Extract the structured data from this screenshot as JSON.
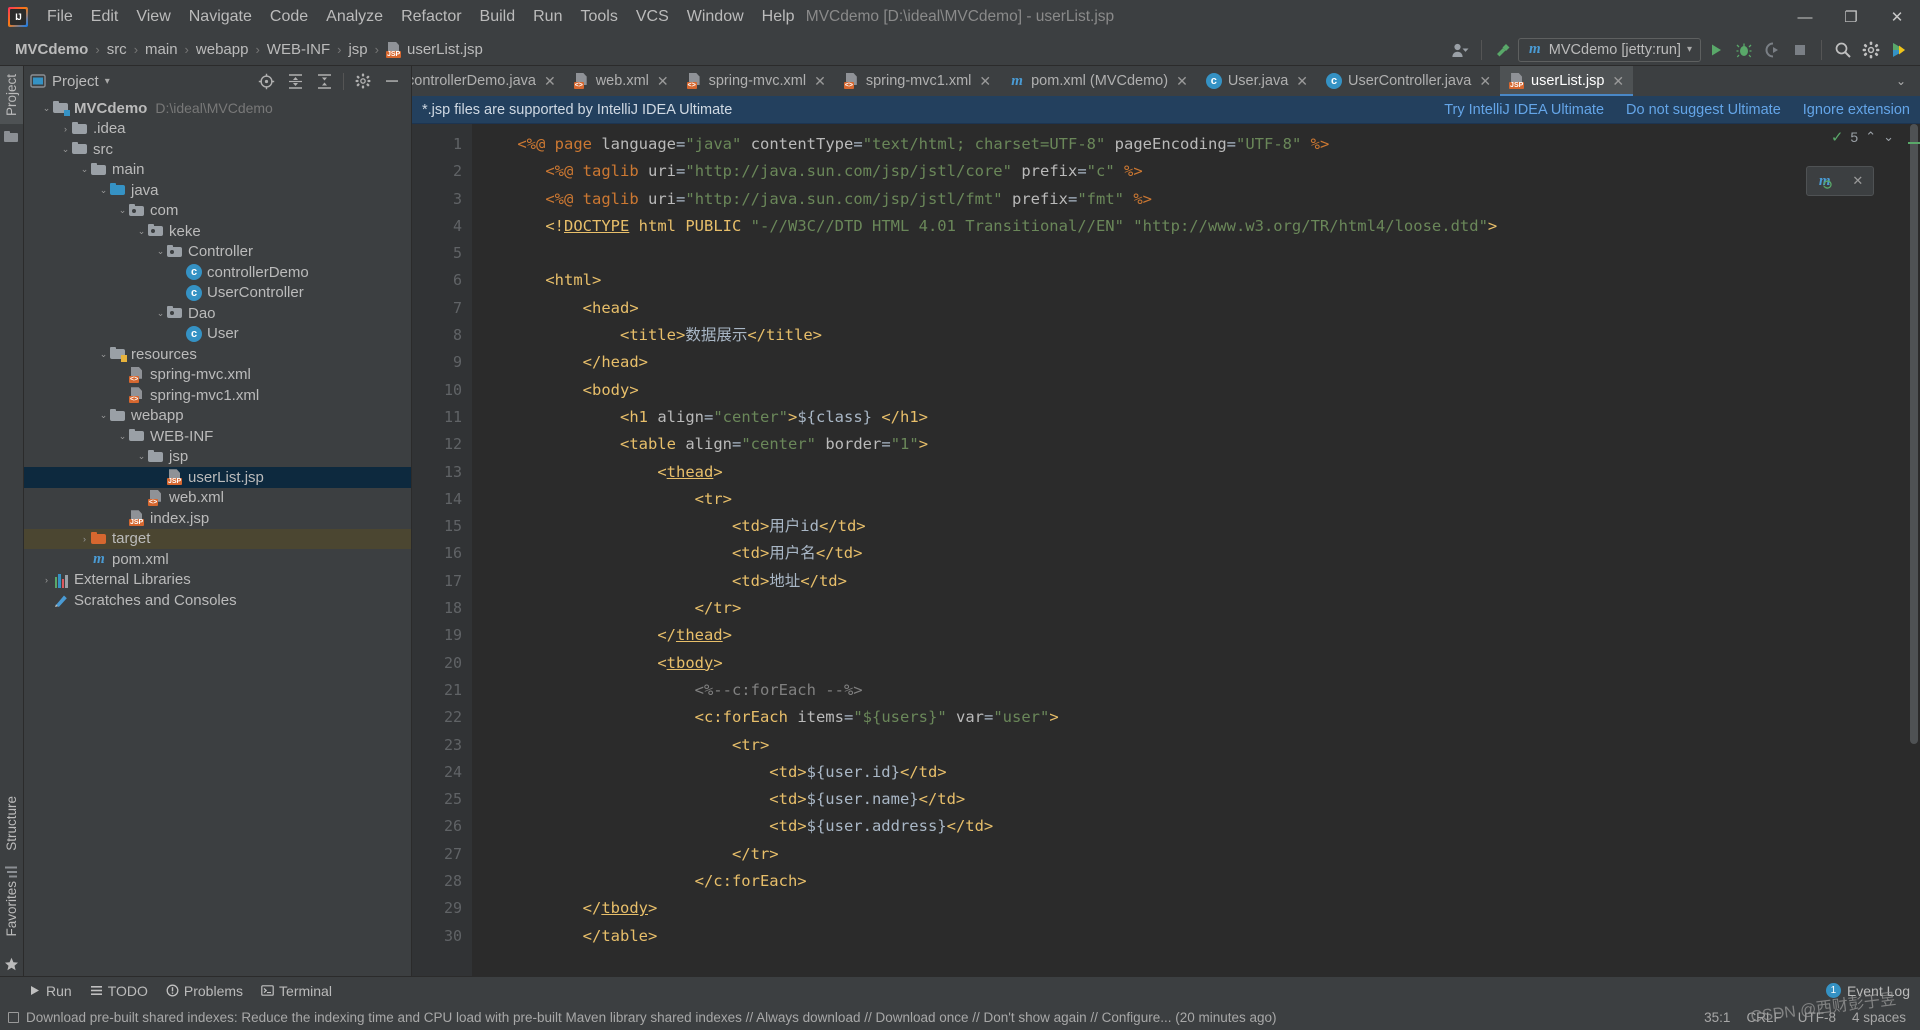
{
  "window": {
    "title": "MVCdemo [D:\\ideal\\MVCdemo] - userList.jsp",
    "minimize": "—",
    "maximize": "❐",
    "close": "✕"
  },
  "menu": {
    "items": [
      "File",
      "Edit",
      "View",
      "Navigate",
      "Code",
      "Analyze",
      "Refactor",
      "Build",
      "Run",
      "Tools",
      "VCS",
      "Window",
      "Help"
    ]
  },
  "navbar": {
    "crumbs": [
      "MVCdemo",
      "src",
      "main",
      "webapp",
      "WEB-INF",
      "jsp",
      "userList.jsp"
    ],
    "separator": "›",
    "run_config": "MVCdemo [jetty:run]",
    "run_config_caret": "▾",
    "icons": [
      "user-avatar-icon",
      "hammer-build-icon",
      "run-icon",
      "debug-icon",
      "run-with-coverage-icon",
      "stop-icon",
      "search-everywhere-icon",
      "settings-gear-icon",
      "update-icon"
    ]
  },
  "left_rail": {
    "project_tab": "Project",
    "structure_tab": "Structure",
    "favorites_tab": "Favorites"
  },
  "project_panel": {
    "title": "Project",
    "caret": "▾",
    "toolbar_icons": [
      "locate-icon",
      "expand-all-icon",
      "collapse-all-icon",
      "settings-gear-icon",
      "hide-icon"
    ],
    "tree": [
      {
        "depth": 0,
        "arrow": "⌄",
        "icon": "module-folder",
        "label": "MVCdemo",
        "bold": true,
        "path": "D:\\ideal\\MVCdemo"
      },
      {
        "depth": 1,
        "arrow": "›",
        "icon": "folder-grey",
        "label": ".idea"
      },
      {
        "depth": 1,
        "arrow": "⌄",
        "icon": "folder-grey",
        "label": "src"
      },
      {
        "depth": 2,
        "arrow": "⌄",
        "icon": "folder-grey",
        "label": "main"
      },
      {
        "depth": 3,
        "arrow": "⌄",
        "icon": "folder-blue-source",
        "label": "java"
      },
      {
        "depth": 4,
        "arrow": "⌄",
        "icon": "package-folder",
        "label": "com"
      },
      {
        "depth": 5,
        "arrow": "⌄",
        "icon": "package-folder",
        "label": "keke"
      },
      {
        "depth": 6,
        "arrow": "⌄",
        "icon": "package-folder",
        "label": "Controller"
      },
      {
        "depth": 7,
        "arrow": "",
        "icon": "java-class",
        "label": "controllerDemo"
      },
      {
        "depth": 7,
        "arrow": "",
        "icon": "java-class",
        "label": "UserController"
      },
      {
        "depth": 6,
        "arrow": "⌄",
        "icon": "package-folder",
        "label": "Dao"
      },
      {
        "depth": 7,
        "arrow": "",
        "icon": "java-class",
        "label": "User"
      },
      {
        "depth": 3,
        "arrow": "⌄",
        "icon": "folder-resources",
        "label": "resources"
      },
      {
        "depth": 4,
        "arrow": "",
        "icon": "xml-file",
        "label": "spring-mvc.xml"
      },
      {
        "depth": 4,
        "arrow": "",
        "icon": "xml-file",
        "label": "spring-mvc1.xml"
      },
      {
        "depth": 3,
        "arrow": "⌄",
        "icon": "folder-grey",
        "label": "webapp"
      },
      {
        "depth": 4,
        "arrow": "⌄",
        "icon": "folder-grey",
        "label": "WEB-INF"
      },
      {
        "depth": 5,
        "arrow": "⌄",
        "icon": "folder-grey",
        "label": "jsp"
      },
      {
        "depth": 6,
        "arrow": "",
        "icon": "jsp-file",
        "label": "userList.jsp",
        "selected": true
      },
      {
        "depth": 5,
        "arrow": "",
        "icon": "xml-file",
        "label": "web.xml"
      },
      {
        "depth": 4,
        "arrow": "",
        "icon": "jsp-file",
        "label": "index.jsp"
      },
      {
        "depth": 2,
        "arrow": "›",
        "icon": "folder-orange",
        "label": "target",
        "highlight": true
      },
      {
        "depth": 2,
        "arrow": "",
        "icon": "maven-file",
        "label": "pom.xml"
      },
      {
        "depth": 0,
        "arrow": "›",
        "icon": "libraries",
        "label": "External Libraries"
      },
      {
        "depth": 0,
        "arrow": "",
        "icon": "scratches",
        "label": "Scratches and Consoles"
      }
    ]
  },
  "editor_tabs": {
    "tabs": [
      {
        "label": "controllerDemo.java",
        "icon": "java-class",
        "active": false,
        "truncated": true
      },
      {
        "label": "web.xml",
        "icon": "xml-file",
        "active": false
      },
      {
        "label": "spring-mvc.xml",
        "icon": "xml-file",
        "active": false
      },
      {
        "label": "spring-mvc1.xml",
        "icon": "xml-file",
        "active": false
      },
      {
        "label": "pom.xml (MVCdemo)",
        "icon": "maven-file",
        "active": false
      },
      {
        "label": "User.java",
        "icon": "java-class",
        "active": false
      },
      {
        "label": "UserController.java",
        "icon": "java-class",
        "active": false
      },
      {
        "label": "userList.jsp",
        "icon": "jsp-file",
        "active": true
      }
    ],
    "close_glyph": "✕",
    "overflow_glyph": "⌄"
  },
  "banner": {
    "message": "*.jsp files are supported by IntelliJ IDEA Ultimate",
    "links": [
      "Try IntelliJ IDEA Ultimate",
      "Do not suggest Ultimate",
      "Ignore extension"
    ]
  },
  "editor": {
    "inspection_count": "5",
    "inspection_ok": "✓",
    "up_glyph": "⌃",
    "down_glyph": "⌄",
    "float_icon": "maven-reload-icon",
    "float_close": "✕",
    "first_line": 1,
    "lines": [
      {
        "n": 1,
        "html": "    <span class='jsp'>&lt;%@</span> <span class='jsp'>page</span> <span class='attr'>language</span>=<span class='str'>\"java\"</span> <span class='attr'>contentType</span>=<span class='str'>\"text/html; charset=UTF-8\"</span> <span class='attr'>pageEncoding</span>=<span class='str'>\"UTF-8\"</span> <span class='jsp'>%&gt;</span>"
      },
      {
        "n": 2,
        "html": "       <span class='jsp'>&lt;%@</span> <span class='jsp'>taglib</span> <span class='attr'>uri</span>=<span class='str'>\"http://java.sun.com/jsp/jstl/core\"</span> <span class='attr'>prefix</span>=<span class='str'>\"c\"</span> <span class='jsp'>%&gt;</span>"
      },
      {
        "n": 3,
        "html": "       <span class='jsp'>&lt;%@</span> <span class='jsp'>taglib</span> <span class='attr'>uri</span>=<span class='str'>\"http://java.sun.com/jsp/jstl/fmt\"</span> <span class='attr'>prefix</span>=<span class='str'>\"fmt\"</span> <span class='jsp'>%&gt;</span>"
      },
      {
        "n": 4,
        "html": "       <span class='tag'>&lt;!</span><span class='doctype'>DOCTYPE</span> <span class='tag'>html PUBLIC</span> <span class='str'>\"-//W3C//DTD HTML 4.01 Transitional//EN\"</span> <span class='str'>\"http://www.w3.org/TR/html4/loose.dtd\"</span><span class='tag'>&gt;</span>"
      },
      {
        "n": 5,
        "html": ""
      },
      {
        "n": 6,
        "html": "       <span class='tag'>&lt;html&gt;</span>"
      },
      {
        "n": 7,
        "html": "           <span class='tag'>&lt;head&gt;</span>"
      },
      {
        "n": 8,
        "html": "               <span class='tag'>&lt;title&gt;</span><span class='plain'>数据展示</span><span class='tag'>&lt;/title&gt;</span>"
      },
      {
        "n": 9,
        "html": "           <span class='tag'>&lt;/head&gt;</span>"
      },
      {
        "n": 10,
        "html": "           <span class='tag'>&lt;body&gt;</span>"
      },
      {
        "n": 11,
        "html": "               <span class='tag'>&lt;h1</span> <span class='attr'>align</span>=<span class='str'>\"center\"</span><span class='tag'>&gt;</span><span class='plain'>${class} </span><span class='tag'>&lt;/h1&gt;</span>"
      },
      {
        "n": 12,
        "html": "               <span class='tag'>&lt;table</span> <span class='attr'>align</span>=<span class='str'>\"center\"</span> <span class='attr'>border</span>=<span class='str'>\"1\"</span><span class='tag'>&gt;</span>"
      },
      {
        "n": 13,
        "html": "                   <span class='tag'>&lt;</span><span class='tagname-u'>thead</span><span class='tag'>&gt;</span>"
      },
      {
        "n": 14,
        "html": "                       <span class='tag'>&lt;tr&gt;</span>"
      },
      {
        "n": 15,
        "html": "                           <span class='tag'>&lt;td&gt;</span><span class='plain'>用户id</span><span class='tag'>&lt;/td&gt;</span>"
      },
      {
        "n": 16,
        "html": "                           <span class='tag'>&lt;td&gt;</span><span class='plain'>用户名</span><span class='tag'>&lt;/td&gt;</span>"
      },
      {
        "n": 17,
        "html": "                           <span class='tag'>&lt;td&gt;</span><span class='plain'>地址</span><span class='tag'>&lt;/td&gt;</span>"
      },
      {
        "n": 18,
        "html": "                       <span class='tag'>&lt;/tr&gt;</span>"
      },
      {
        "n": 19,
        "html": "                   <span class='tag'>&lt;/</span><span class='tagname-u'>thead</span><span class='tag'>&gt;</span>"
      },
      {
        "n": 20,
        "html": "                   <span class='tag'>&lt;</span><span class='tagname-u'>tbody</span><span class='tag'>&gt;</span>"
      },
      {
        "n": 21,
        "html": "                       <span class='cmt'>&lt;%--c:forEach --%&gt;</span>"
      },
      {
        "n": 22,
        "html": "                       <span class='tag'>&lt;c:forEach</span> <span class='attr'>items</span>=<span class='str'>\"${users}\"</span> <span class='attr'>var</span>=<span class='str'>\"user\"</span><span class='tag'>&gt;</span>"
      },
      {
        "n": 23,
        "html": "                           <span class='tag'>&lt;tr&gt;</span>"
      },
      {
        "n": 24,
        "html": "                               <span class='tag'>&lt;td&gt;</span><span class='plain'>${user.id}</span><span class='tag'>&lt;/td&gt;</span>"
      },
      {
        "n": 25,
        "html": "                               <span class='tag'>&lt;td&gt;</span><span class='plain'>${user.name}</span><span class='tag'>&lt;/td&gt;</span>"
      },
      {
        "n": 26,
        "html": "                               <span class='tag'>&lt;td&gt;</span><span class='plain'>${user.address}</span><span class='tag'>&lt;/td&gt;</span>"
      },
      {
        "n": 27,
        "html": "                           <span class='tag'>&lt;/tr&gt;</span>"
      },
      {
        "n": 28,
        "html": "                       <span class='tag'>&lt;/c:forEach&gt;</span>"
      },
      {
        "n": 29,
        "html": "           <span class='tag'>&lt;/</span><span class='tagname-u'>tbody</span><span class='tag'>&gt;</span>"
      },
      {
        "n": 30,
        "html": "           <span class='tag'>&lt;/table&gt;</span>"
      }
    ]
  },
  "bottom_bar": {
    "items": [
      {
        "label": "Run",
        "icon": "run-icon"
      },
      {
        "label": "TODO",
        "icon": "todo-icon"
      },
      {
        "label": "Problems",
        "icon": "problems-icon"
      },
      {
        "label": "Terminal",
        "icon": "terminal-icon"
      }
    ],
    "event_log": "Event Log",
    "event_count": "1"
  },
  "status_bar": {
    "message": "Download pre-built shared indexes: Reduce the indexing time and CPU load with pre-built Maven library shared indexes // Always download // Download once // Don't show again // Configure... (20 minutes ago)",
    "caret_position": "35:1",
    "line_separator": "CRLF",
    "encoding": "UTF-8",
    "indent": "4 spaces",
    "watermark": "CSDN @西财彭于昱"
  },
  "colors": {
    "accent": "#4a88c7",
    "selection": "#0d293e",
    "banner_bg": "#23405e",
    "panel_bg": "#3c3f41",
    "editor_bg": "#2b2b2b"
  }
}
